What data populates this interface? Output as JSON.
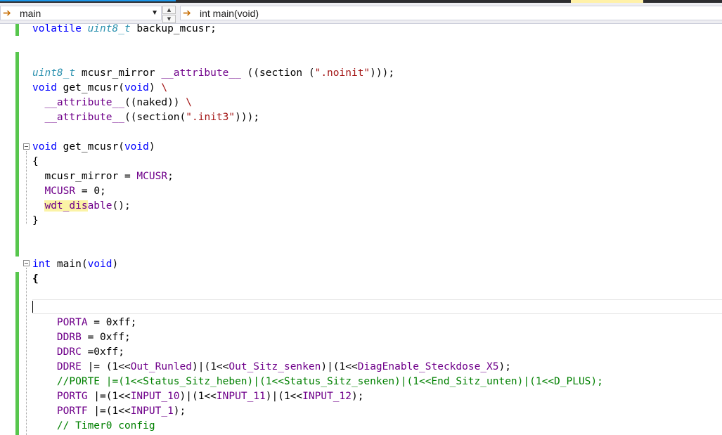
{
  "navbar": {
    "scope_combo": "main",
    "member_combo": "int main(void)"
  },
  "code": {
    "l1": [
      "volatile ",
      "uint8_t",
      " backup_mcusr;"
    ],
    "l4": [
      "uint8_t",
      " mcusr_mirror ",
      "__attribute__",
      " ((section (",
      "\".noinit\"",
      ")));"
    ],
    "l5": [
      "void",
      " get_mcusr(",
      "void",
      ") ",
      "\\"
    ],
    "l6": [
      "  ",
      "__attribute__",
      "((naked)) ",
      "\\"
    ],
    "l7": [
      "  ",
      "__attribute__",
      "((section(",
      "\".init3\"",
      ")));"
    ],
    "l9": [
      "void",
      " get_mcusr(",
      "void",
      ")"
    ],
    "l10": "{",
    "l11": [
      "  mcusr_mirror = ",
      "MCUSR",
      ";"
    ],
    "l12": [
      "  ",
      "MCUSR",
      " = 0;"
    ],
    "l13": [
      "  ",
      "wdt_dis",
      "able",
      "();"
    ],
    "l14": "}",
    "l17": [
      "int",
      " main(",
      "void",
      ")"
    ],
    "l18": "{",
    "l20": [
      "    ",
      "PORTA",
      " = 0xff;"
    ],
    "l21": [
      "    ",
      "DDRB",
      " = 0xff;"
    ],
    "l22": [
      "    ",
      "DDRC",
      " =0xff;"
    ],
    "l23": [
      "    ",
      "DDRE",
      " |= (1<<",
      "Out_Runled",
      ")|(1<<",
      "Out_Sitz_senken",
      ")|(1<<",
      "DiagEnable_Steckdose_X5",
      ");"
    ],
    "l24": "    //PORTE |=(1<<Status_Sitz_heben)|(1<<Status_Sitz_senken)|(1<<End_Sitz_unten)|(1<<D_PLUS);",
    "l25": [
      "    ",
      "PORTG",
      " |=(1<<",
      "INPUT_10",
      ")|(1<<",
      "INPUT_11",
      ")|(1<<",
      "INPUT_12",
      ");"
    ],
    "l26": [
      "    ",
      "PORTF",
      " |=(1<<",
      "INPUT_1",
      ");"
    ],
    "l27": "    // Timer0 config"
  }
}
